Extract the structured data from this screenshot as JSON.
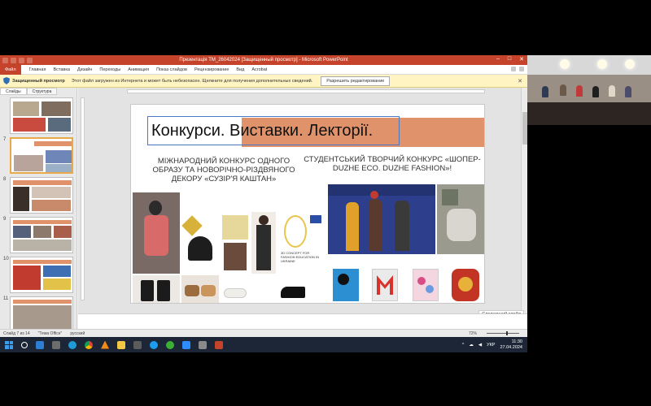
{
  "window": {
    "title": "Презентація ТМ_26042024 [Защищенный просмотр] - Microsoft PowerPoint"
  },
  "ribbon": {
    "file_tab": "Файл",
    "tabs": [
      "Главная",
      "Вставка",
      "Дизайн",
      "Переходы",
      "Анимация",
      "Показ слайдов",
      "Рецензирование",
      "Вид",
      "Acrobat"
    ]
  },
  "protected_bar": {
    "label": "Защищенный просмотр",
    "message": "Этот файл загружен из Интернета и может быть небезопасен. Щелкните для получения дополнительных сведений.",
    "button": "Разрешить редактирование"
  },
  "left_pane": {
    "tab_slides": "Слайды",
    "tab_outline": "Структура",
    "slide_numbers": [
      "",
      "7",
      "8",
      "9",
      "10",
      "11"
    ]
  },
  "slide": {
    "title": "Конкурси. Виставки. Лекторії.",
    "left_heading": "МІЖНАРОДНИЙ КОНКУРС ОДНОГО ОБРАЗУ ТА НОВОРІЧНО-РІЗДВЯНОГО ДЕКОРУ «СУЗІР'Я КАШТАН»",
    "right_heading": "СТУДЕНТСЬКИЙ ТВОРЧИЙ КОНКУРС «ШОПЕР-DUZHE ECO. DUZHE FASHION»!",
    "poster_text": "3D CONCEPT FOR FASHION EDUCATION IN UKRAINE"
  },
  "next_slide": "Следующий слайд",
  "status": {
    "slide_info": "Слайд 7 из 14",
    "theme": "\"Тема Office\"",
    "language": "русский",
    "zoom": "72%"
  },
  "taskbar": {
    "language": "УКР",
    "time": "11:30",
    "date": "27.04.2024"
  },
  "colors": {
    "ppt_accent": "#c4432a",
    "title_band": "#e0936a",
    "taskbar": "#1c2636",
    "protected_bar": "#fff4c2"
  }
}
